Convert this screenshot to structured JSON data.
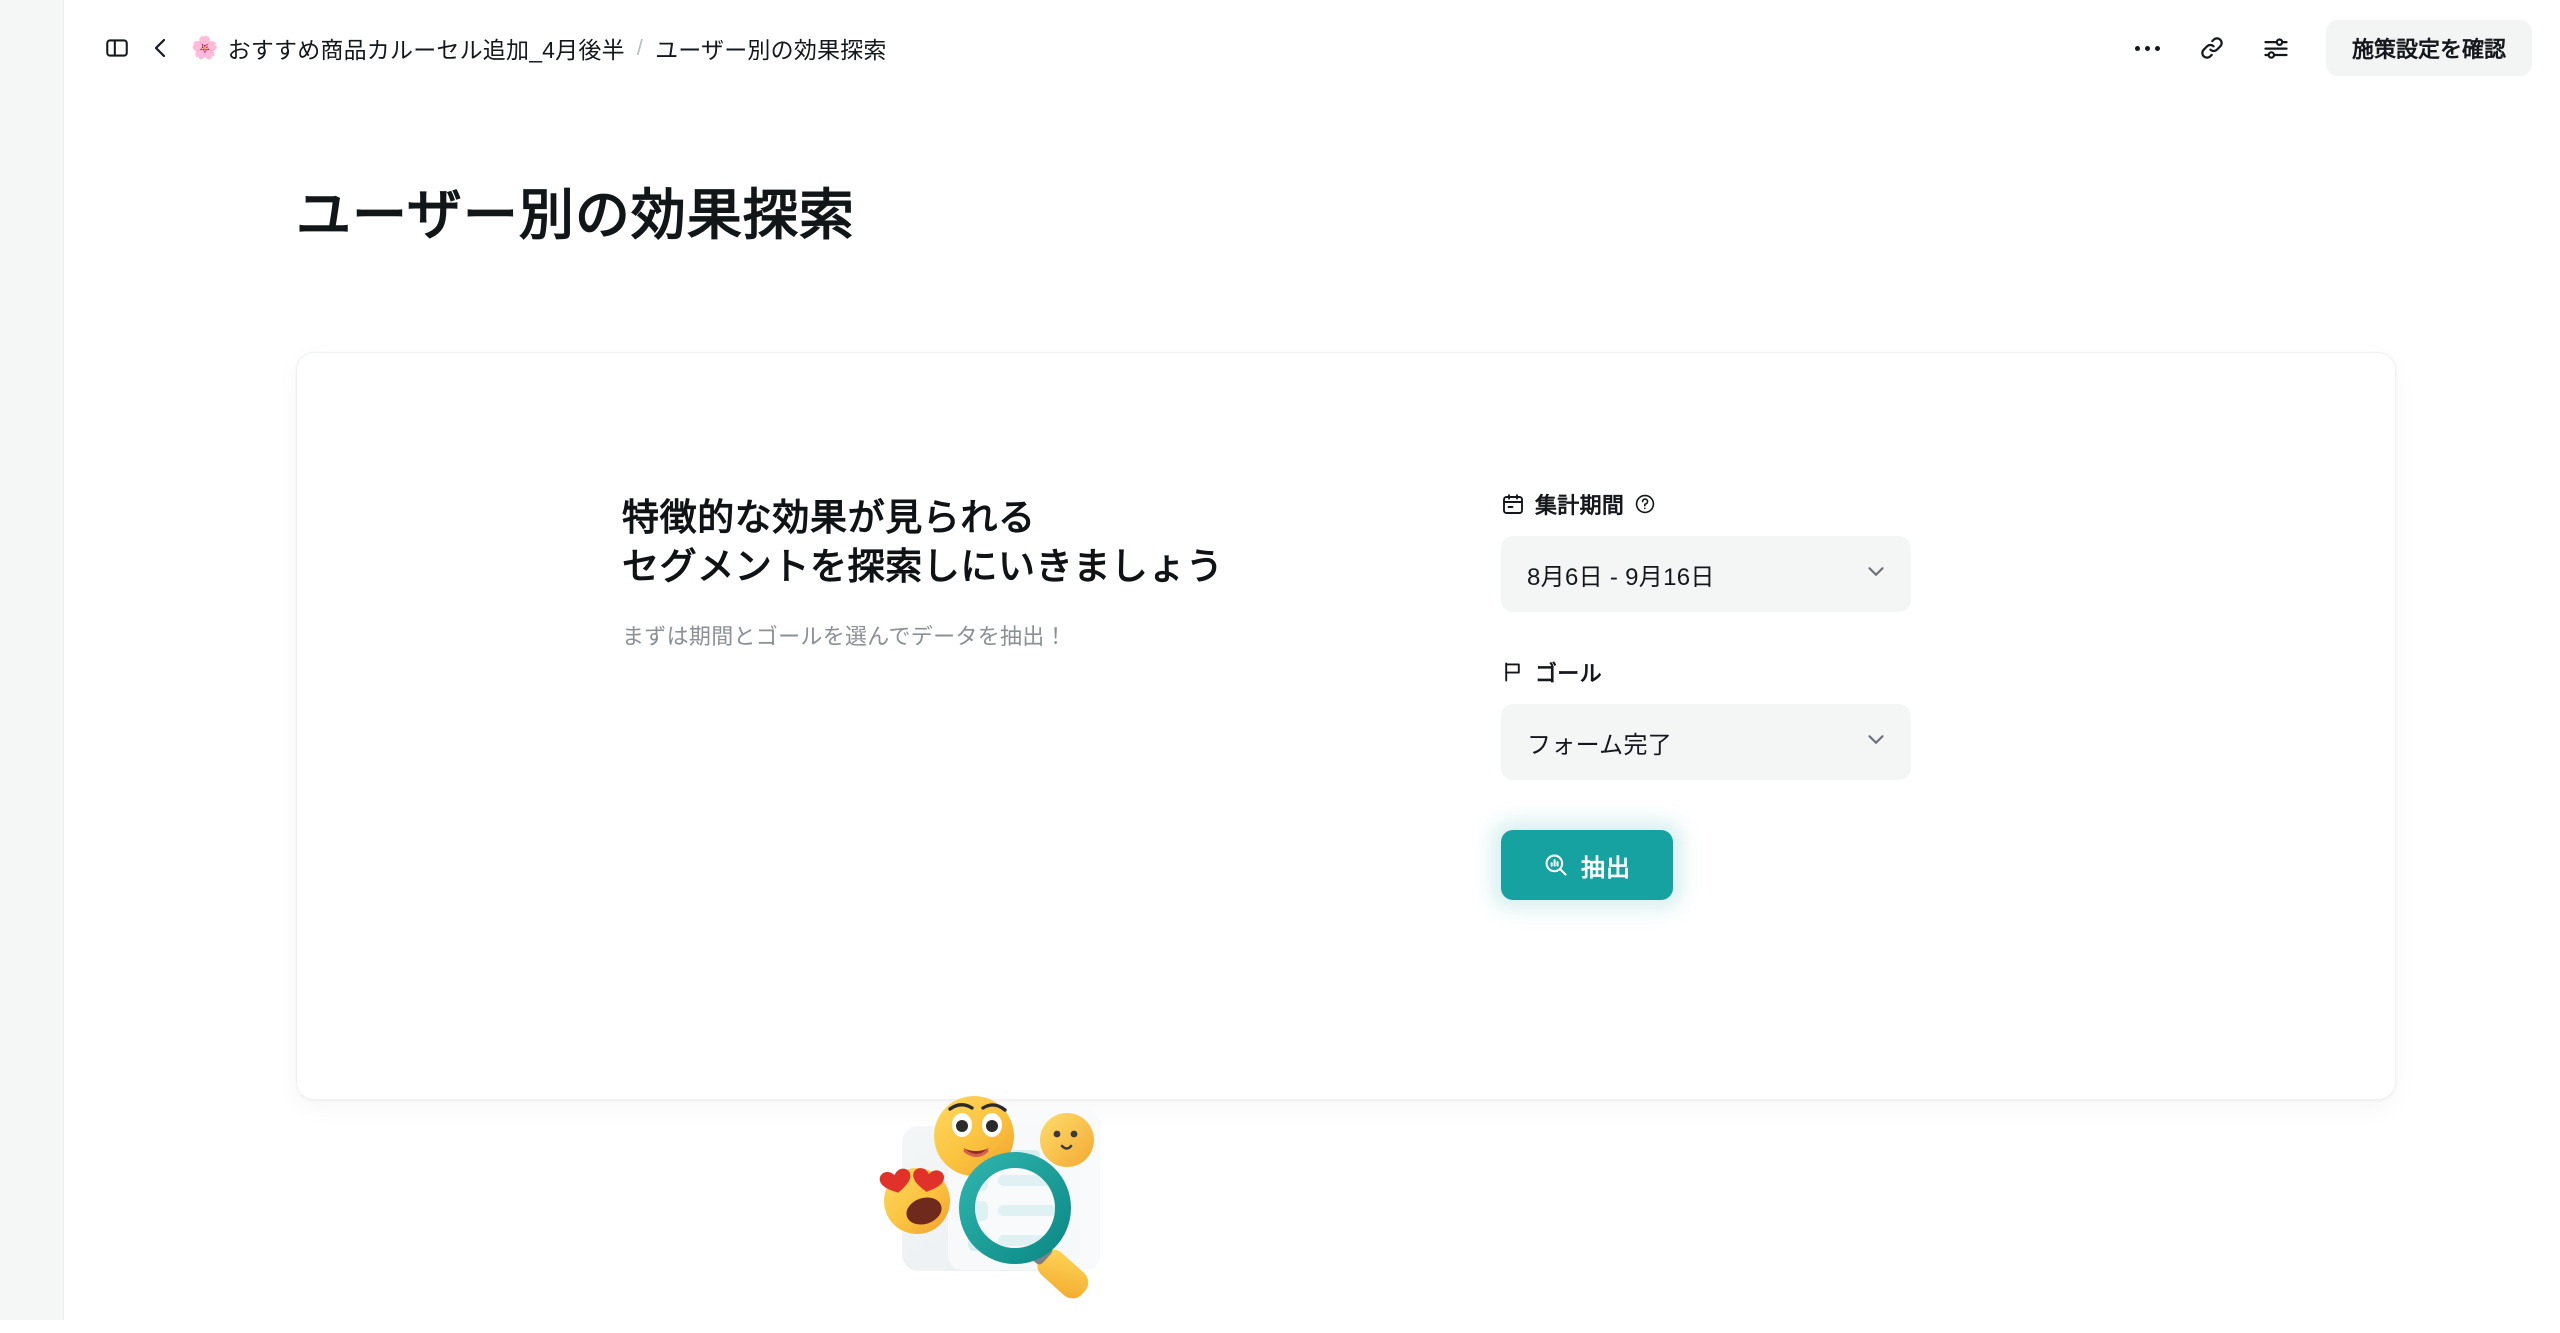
{
  "header": {
    "sidebar_toggle_title": "サイドバー",
    "back_title": "戻る",
    "breadcrumb": {
      "emoji": "🌸",
      "parent": "おすすめ商品カルーセル追加_4月後半",
      "separator": "/",
      "current": "ユーザー別の効果探索"
    },
    "more_title": "その他",
    "link_title": "リンクをコピー",
    "settings_title": "表示設定",
    "primary_button": "施策設定を確認"
  },
  "page": {
    "title": "ユーザー別の効果探索"
  },
  "card": {
    "headline_line1": "特徴的な効果が見られる",
    "headline_line2": "セグメントを探索しにいきましょう",
    "subtext": "まずは期間とゴールを選んでデータを抽出！",
    "illustration_name": "search-emoji-illustration"
  },
  "form": {
    "period": {
      "label": "集計期間",
      "help_icon": "help-circle-icon",
      "calendar_icon": "calendar-icon",
      "value": "8月6日 - 9月16日",
      "chevron_icon": "chevron-down-icon"
    },
    "goal": {
      "label": "ゴール",
      "flag_icon": "flag-icon",
      "value": "フォーム完了",
      "chevron_icon": "chevron-down-icon"
    },
    "submit": {
      "label": "抽出",
      "icon": "chart-search-icon"
    }
  },
  "colors": {
    "accent": "#17a2a2",
    "page_bg": "#ffffff",
    "rail_bg": "#f5f6f6",
    "field_bg": "#f4f5f5",
    "text": "#14181c",
    "muted_text": "#8a9096"
  }
}
